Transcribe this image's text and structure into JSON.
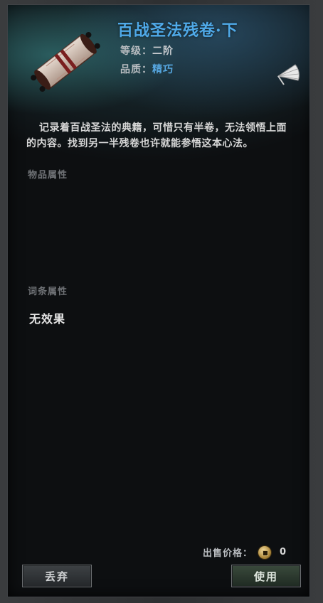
{
  "item": {
    "name": "百战圣法残卷·下",
    "level_label": "等级：",
    "level_value": "二阶",
    "quality_label": "品质：",
    "quality_value": "精巧",
    "icon": "scroll-icon",
    "badge_icon": "fan-icon"
  },
  "description": "记录着百战圣法的典籍，可惜只有半卷，无法领悟上面的内容。找到另一半残卷也许就能参悟这本心法。",
  "sections": {
    "item_attributes": "物品属性",
    "affix_attributes": "词条属性",
    "affix_value": "无效果"
  },
  "price": {
    "label": "出售价格：",
    "value": "0",
    "icon": "coin-icon"
  },
  "buttons": {
    "discard": "丢弃",
    "use": "使用"
  },
  "colors": {
    "title": "#4fa9e8",
    "quality": "#57a8e2",
    "panel_bg": "#0d0f11"
  }
}
